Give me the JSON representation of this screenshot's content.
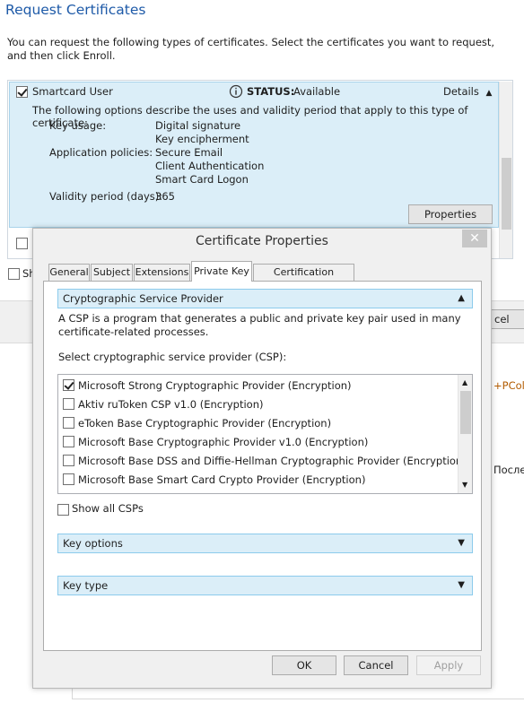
{
  "wizard": {
    "title": "Request Certificates",
    "intro": "You can request the following types of certificates. Select the certificates you want to request, and then click Enroll.",
    "certificate": {
      "name": "Smartcard User",
      "status_label": "STATUS:",
      "status_value": "Available",
      "details_label": "Details",
      "description": "The following options describe the uses and validity period that apply to this type of certificate:",
      "key_usage_label": "Key usage:",
      "key_usage": [
        "Digital signature",
        "Key encipherment"
      ],
      "app_policies_label": "Application policies:",
      "app_policies": [
        "Secure Email",
        "Client Authentication",
        "Smart Card Logon"
      ],
      "validity_label": "Validity period (days):",
      "validity_value": "365",
      "properties_button": "Properties"
    },
    "show_all_partial": "Sh",
    "cancel_partial": "cel",
    "right_partial_1": "+PColl",
    "right_partial_2": "После"
  },
  "dialog": {
    "title": "Certificate Properties",
    "close_glyph": "✕",
    "tabs": [
      "General",
      "Subject",
      "Extensions",
      "Private Key",
      "Certification Authority"
    ],
    "active_tab": "Private Key",
    "csp_section": {
      "header": "Cryptographic Service Provider",
      "description": "A CSP is a program that generates a public and private key pair used in many certificate-related processes.",
      "select_label": "Select cryptographic service provider (CSP):",
      "providers": [
        {
          "name": "Microsoft Strong Cryptographic Provider (Encryption)",
          "checked": true
        },
        {
          "name": "Aktiv ruToken CSP v1.0 (Encryption)",
          "checked": false
        },
        {
          "name": "eToken Base Cryptographic Provider (Encryption)",
          "checked": false
        },
        {
          "name": "Microsoft Base Cryptographic Provider v1.0 (Encryption)",
          "checked": false
        },
        {
          "name": "Microsoft Base DSS and Diffie-Hellman Cryptographic Provider (Encryption)",
          "checked": false
        },
        {
          "name": "Microsoft Base Smart Card Crypto Provider (Encryption)",
          "checked": false
        }
      ],
      "show_all_label": "Show all CSPs"
    },
    "key_options_header": "Key options",
    "key_type_header": "Key type",
    "buttons": {
      "ok": "OK",
      "cancel": "Cancel",
      "apply": "Apply"
    }
  }
}
